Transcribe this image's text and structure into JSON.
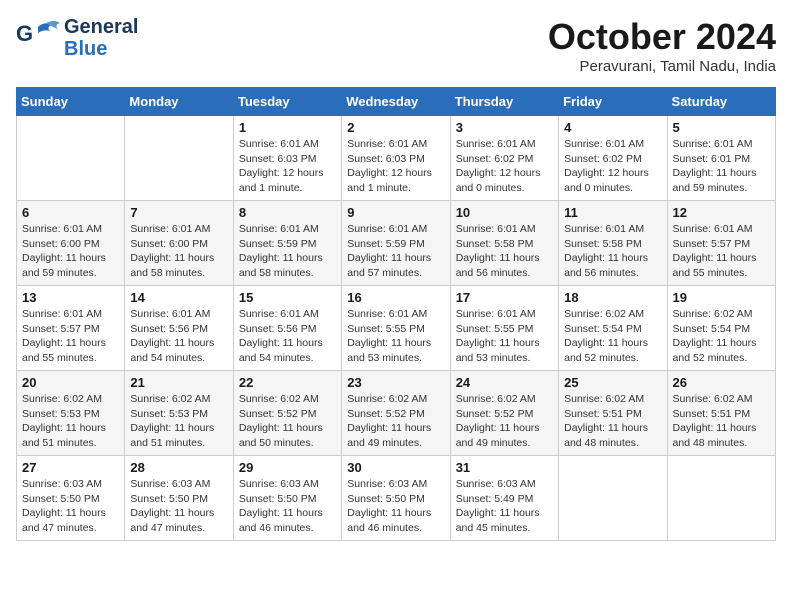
{
  "header": {
    "logo_line1": "General",
    "logo_line2": "Blue",
    "month": "October 2024",
    "location": "Peravurani, Tamil Nadu, India"
  },
  "days_of_week": [
    "Sunday",
    "Monday",
    "Tuesday",
    "Wednesday",
    "Thursday",
    "Friday",
    "Saturday"
  ],
  "weeks": [
    [
      {
        "day": "",
        "detail": ""
      },
      {
        "day": "",
        "detail": ""
      },
      {
        "day": "1",
        "detail": "Sunrise: 6:01 AM\nSunset: 6:03 PM\nDaylight: 12 hours\nand 1 minute."
      },
      {
        "day": "2",
        "detail": "Sunrise: 6:01 AM\nSunset: 6:03 PM\nDaylight: 12 hours\nand 1 minute."
      },
      {
        "day": "3",
        "detail": "Sunrise: 6:01 AM\nSunset: 6:02 PM\nDaylight: 12 hours\nand 0 minutes."
      },
      {
        "day": "4",
        "detail": "Sunrise: 6:01 AM\nSunset: 6:02 PM\nDaylight: 12 hours\nand 0 minutes."
      },
      {
        "day": "5",
        "detail": "Sunrise: 6:01 AM\nSunset: 6:01 PM\nDaylight: 11 hours\nand 59 minutes."
      }
    ],
    [
      {
        "day": "6",
        "detail": "Sunrise: 6:01 AM\nSunset: 6:00 PM\nDaylight: 11 hours\nand 59 minutes."
      },
      {
        "day": "7",
        "detail": "Sunrise: 6:01 AM\nSunset: 6:00 PM\nDaylight: 11 hours\nand 58 minutes."
      },
      {
        "day": "8",
        "detail": "Sunrise: 6:01 AM\nSunset: 5:59 PM\nDaylight: 11 hours\nand 58 minutes."
      },
      {
        "day": "9",
        "detail": "Sunrise: 6:01 AM\nSunset: 5:59 PM\nDaylight: 11 hours\nand 57 minutes."
      },
      {
        "day": "10",
        "detail": "Sunrise: 6:01 AM\nSunset: 5:58 PM\nDaylight: 11 hours\nand 56 minutes."
      },
      {
        "day": "11",
        "detail": "Sunrise: 6:01 AM\nSunset: 5:58 PM\nDaylight: 11 hours\nand 56 minutes."
      },
      {
        "day": "12",
        "detail": "Sunrise: 6:01 AM\nSunset: 5:57 PM\nDaylight: 11 hours\nand 55 minutes."
      }
    ],
    [
      {
        "day": "13",
        "detail": "Sunrise: 6:01 AM\nSunset: 5:57 PM\nDaylight: 11 hours\nand 55 minutes."
      },
      {
        "day": "14",
        "detail": "Sunrise: 6:01 AM\nSunset: 5:56 PM\nDaylight: 11 hours\nand 54 minutes."
      },
      {
        "day": "15",
        "detail": "Sunrise: 6:01 AM\nSunset: 5:56 PM\nDaylight: 11 hours\nand 54 minutes."
      },
      {
        "day": "16",
        "detail": "Sunrise: 6:01 AM\nSunset: 5:55 PM\nDaylight: 11 hours\nand 53 minutes."
      },
      {
        "day": "17",
        "detail": "Sunrise: 6:01 AM\nSunset: 5:55 PM\nDaylight: 11 hours\nand 53 minutes."
      },
      {
        "day": "18",
        "detail": "Sunrise: 6:02 AM\nSunset: 5:54 PM\nDaylight: 11 hours\nand 52 minutes."
      },
      {
        "day": "19",
        "detail": "Sunrise: 6:02 AM\nSunset: 5:54 PM\nDaylight: 11 hours\nand 52 minutes."
      }
    ],
    [
      {
        "day": "20",
        "detail": "Sunrise: 6:02 AM\nSunset: 5:53 PM\nDaylight: 11 hours\nand 51 minutes."
      },
      {
        "day": "21",
        "detail": "Sunrise: 6:02 AM\nSunset: 5:53 PM\nDaylight: 11 hours\nand 51 minutes."
      },
      {
        "day": "22",
        "detail": "Sunrise: 6:02 AM\nSunset: 5:52 PM\nDaylight: 11 hours\nand 50 minutes."
      },
      {
        "day": "23",
        "detail": "Sunrise: 6:02 AM\nSunset: 5:52 PM\nDaylight: 11 hours\nand 49 minutes."
      },
      {
        "day": "24",
        "detail": "Sunrise: 6:02 AM\nSunset: 5:52 PM\nDaylight: 11 hours\nand 49 minutes."
      },
      {
        "day": "25",
        "detail": "Sunrise: 6:02 AM\nSunset: 5:51 PM\nDaylight: 11 hours\nand 48 minutes."
      },
      {
        "day": "26",
        "detail": "Sunrise: 6:02 AM\nSunset: 5:51 PM\nDaylight: 11 hours\nand 48 minutes."
      }
    ],
    [
      {
        "day": "27",
        "detail": "Sunrise: 6:03 AM\nSunset: 5:50 PM\nDaylight: 11 hours\nand 47 minutes."
      },
      {
        "day": "28",
        "detail": "Sunrise: 6:03 AM\nSunset: 5:50 PM\nDaylight: 11 hours\nand 47 minutes."
      },
      {
        "day": "29",
        "detail": "Sunrise: 6:03 AM\nSunset: 5:50 PM\nDaylight: 11 hours\nand 46 minutes."
      },
      {
        "day": "30",
        "detail": "Sunrise: 6:03 AM\nSunset: 5:50 PM\nDaylight: 11 hours\nand 46 minutes."
      },
      {
        "day": "31",
        "detail": "Sunrise: 6:03 AM\nSunset: 5:49 PM\nDaylight: 11 hours\nand 45 minutes."
      },
      {
        "day": "",
        "detail": ""
      },
      {
        "day": "",
        "detail": ""
      }
    ]
  ]
}
